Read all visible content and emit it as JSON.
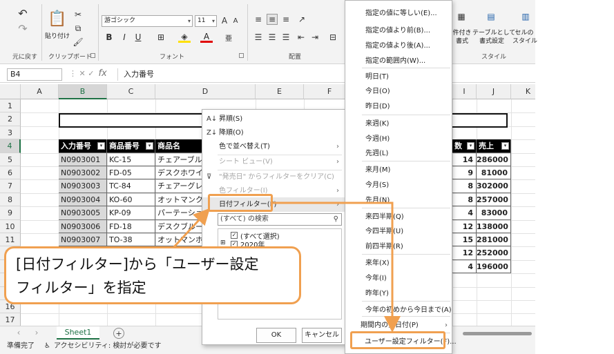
{
  "ribbon": {
    "undo_group_label": "元に戻す",
    "clipboard": {
      "paste_label": "貼り付け",
      "group_label": "クリップボード"
    },
    "font": {
      "name": "游ゴシック",
      "size": "11",
      "group_label": "フォント",
      "bold": "B",
      "italic": "I",
      "underline": "U",
      "grow": "A",
      "shrink": "A"
    },
    "alignment": {
      "group_label": "配置"
    },
    "styles": {
      "conditional_label": "件付き",
      "conditional_label2": "書式",
      "table_label": "テーブルとして",
      "table_label2": "書式設定",
      "cell_label": "セルの",
      "cell_label2": "スタイル",
      "group_label": "スタイル"
    }
  },
  "formula_bar": {
    "name_box": "B4",
    "fx": "fx",
    "content": "入力番号"
  },
  "columns": [
    "A",
    "B",
    "C",
    "D",
    "E",
    "F",
    "G",
    "H",
    "I",
    "J",
    "K"
  ],
  "rows": [
    "1",
    "2",
    "3",
    "4",
    "5",
    "6",
    "7",
    "8",
    "9",
    "10",
    "11",
    "12",
    "13",
    "14",
    "15",
    "16",
    "17"
  ],
  "table": {
    "headers": {
      "b": "入力番号",
      "c": "商品番号",
      "d": "商品名",
      "i": "数",
      "j": "売上"
    },
    "rows": [
      {
        "b": "N0903001",
        "c": "KC-15",
        "d": "チェアーブル",
        "i": "14",
        "j": "286000"
      },
      {
        "b": "N0903002",
        "c": "FD-05",
        "d": "デスクホワイ",
        "i": "9",
        "j": "81000"
      },
      {
        "b": "N0903003",
        "c": "TC-84",
        "d": "チェアーグレ",
        "i": "8",
        "j": "302000"
      },
      {
        "b": "N0903004",
        "c": "KO-60",
        "d": "オットマンク",
        "i": "8",
        "j": "257000"
      },
      {
        "b": "N0903005",
        "c": "KP-09",
        "d": "パーテーショ",
        "i": "4",
        "j": "83000"
      },
      {
        "b": "N0903006",
        "c": "FD-18",
        "d": "デスクブルー",
        "i": "12",
        "j": "138000"
      },
      {
        "b": "N0903007",
        "c": "TO-38",
        "d": "オットマンホ",
        "i": "15",
        "j": "281000"
      },
      {
        "i": "12",
        "j": "252000"
      },
      {
        "i": "4",
        "j": "196000"
      }
    ]
  },
  "filter_panel": {
    "sort_asc": "昇順(S)",
    "sort_desc": "降順(O)",
    "sort_color": "色で並べ替え(T)",
    "sheet_view": "シート ビュー(V)",
    "clear_filter": "\"発売日\" からフィルターをクリア(C)",
    "color_filter": "色フィルター(I)",
    "date_filter": "日付フィルター(F)",
    "search_placeholder": "(すべて) の検索",
    "select_all": "(すべて選択)",
    "year_2020": "2020年",
    "ok": "OK",
    "cancel": "キャンセル"
  },
  "date_menu": {
    "items": [
      "指定の値に等しい(E)...",
      "指定の値より前(B)...",
      "指定の値より後(A)...",
      "指定の範囲内(W)...",
      "明日(T)",
      "今日(O)",
      "昨日(D)",
      "来週(K)",
      "今週(H)",
      "先週(L)",
      "来月(M)",
      "今月(S)",
      "先月(N)",
      "来四半期(Q)",
      "今四半期(U)",
      "前四半期(R)",
      "来年(X)",
      "今年(I)",
      "昨年(Y)",
      "今年の初めから今日まで(A)",
      "期間内の全日付(P)",
      "ユーザー設定フィルター(F)..."
    ]
  },
  "sheet_tab": "Sheet1",
  "status": {
    "ready": "準備完了",
    "accessibility": "アクセシビリティ: 検討が必要です"
  },
  "callout": {
    "line1": "[日付フィルター]から「ユーザー設定",
    "line2": "フィルター」を指定"
  },
  "colors": {
    "accent": "#f0a050",
    "excel_green": "#1e7145",
    "header_bg": "#000000",
    "code_bg": "#d9d9d9"
  }
}
